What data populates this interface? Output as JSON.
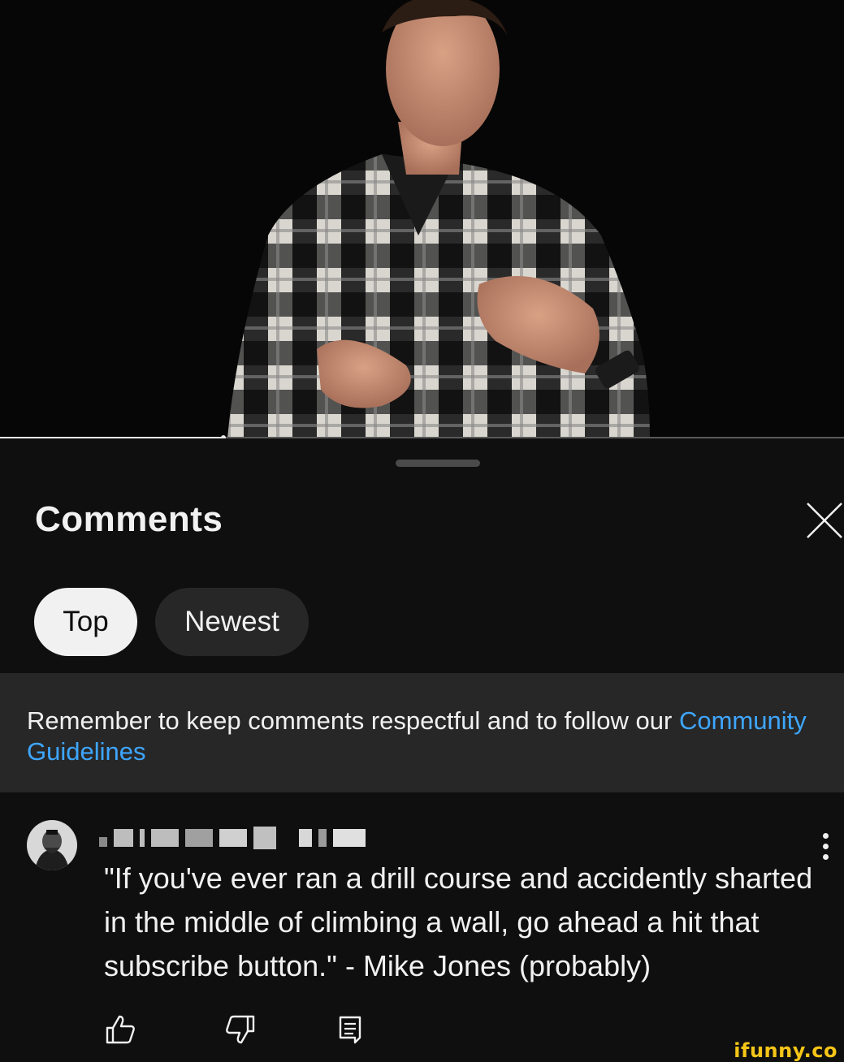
{
  "video": {
    "progress_fraction": 0.265
  },
  "comments_sheet": {
    "title": "Comments",
    "close_icon": "close-icon",
    "sort_chips": [
      {
        "label": "Top",
        "selected": true
      },
      {
        "label": "Newest",
        "selected": false
      }
    ],
    "notice": {
      "text": "Remember to keep comments respectful and to follow our ",
      "link_text": "Community Guidelines",
      "link_color": "#3ea6ff"
    }
  },
  "comment": {
    "author_redacted": true,
    "text": "\"If you've ever ran a drill course and accidently sharted in the middle of climbing a wall, go ahead a hit that subscribe button.\" - Mike Jones (probably)",
    "menu_icon": "more-vert-icon",
    "actions": {
      "like_icon": "thumbs-up-icon",
      "dislike_icon": "thumbs-down-icon",
      "reply_icon": "reply-icon"
    }
  },
  "watermark": "ifunny.co",
  "colors": {
    "background": "#0f0f0f",
    "chip_active_bg": "#f1f1f1",
    "chip_inactive_bg": "#272727",
    "watermark": "#f5c518"
  }
}
